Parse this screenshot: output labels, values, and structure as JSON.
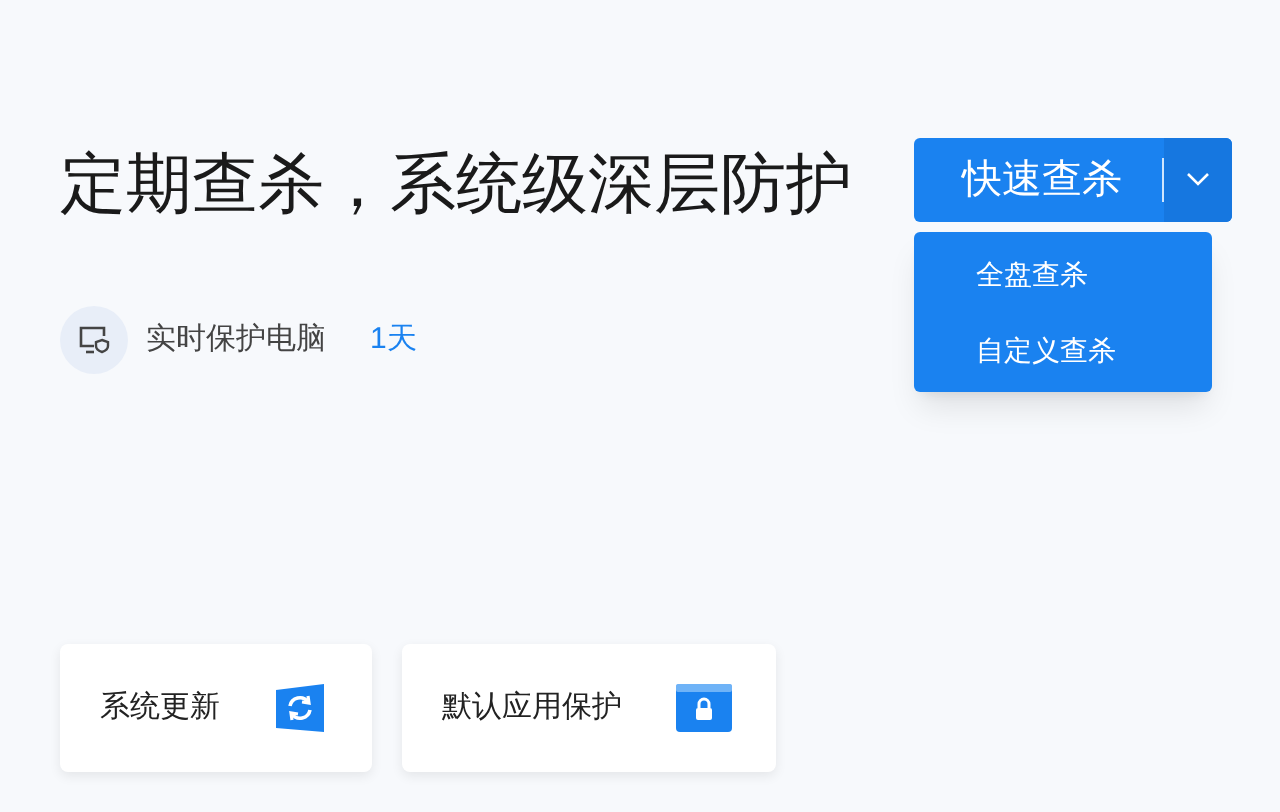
{
  "headline": "定期查杀，系统级深层防护",
  "status": {
    "label": "实时保护电脑",
    "value": "1天"
  },
  "scan_button": {
    "label": "快速查杀",
    "expanded": true,
    "menu": [
      {
        "label": "全盘查杀"
      },
      {
        "label": "自定义查杀"
      }
    ]
  },
  "cards": [
    {
      "label": "系统更新",
      "kind": "update"
    },
    {
      "label": "默认应用保护",
      "kind": "lock"
    }
  ]
}
